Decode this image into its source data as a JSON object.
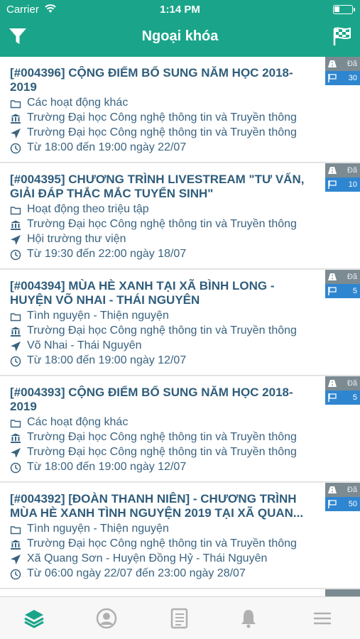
{
  "status": {
    "carrier": "Carrier",
    "time": "1:14 PM"
  },
  "nav": {
    "title": "Ngoại khóa"
  },
  "badge_label": "Đã",
  "activities": [
    {
      "title": "[#004396] CỘNG ĐIỂM BỔ SUNG NĂM HỌC 2018-2019",
      "category": "Các hoạt động khác",
      "organizer": "Trường Đại học Công nghệ thông tin và Truyền thông",
      "location": "Trường Đại học Công nghệ thông tin và Truyền thông",
      "time": "Từ 18:00 đến 19:00 ngày 22/07",
      "count": "30"
    },
    {
      "title": "[#004395] CHƯƠNG TRÌNH LIVESTREAM \"TƯ VẤN, GIẢI ĐÁP THẮC MẮC TUYỂN SINH\"",
      "category": "Hoạt động theo triệu tập",
      "organizer": "Trường Đại học Công nghệ thông tin và Truyền thông",
      "location": "Hội trường thư viện",
      "time": "Từ 19:30 đến 22:00 ngày 18/07",
      "count": "10"
    },
    {
      "title": "[#004394] MÙA HÈ XANH TẠI XÃ BÌNH LONG - HUYỆN VÕ NHAI - THÁI NGUYÊN",
      "category": "Tình nguyện - Thiện nguyện",
      "organizer": "Trường Đại học Công nghệ thông tin và Truyền thông",
      "location": "Võ Nhai - Thái Nguyên",
      "time": "Từ 18:00 đến 19:00 ngày 12/07",
      "count": "5"
    },
    {
      "title": "[#004393] CỘNG ĐIỂM BỔ SUNG NĂM HỌC 2018-2019",
      "category": "Các hoạt động khác",
      "organizer": "Trường Đại học Công nghệ thông tin và Truyền thông",
      "location": "Trường Đại học Công nghệ thông tin và Truyền thông",
      "time": "Từ 18:00 đến 19:00 ngày 12/07",
      "count": "5"
    },
    {
      "title": "[#004392] [ĐOÀN THANH NIÊN] - CHƯƠNG TRÌNH MÙA HÈ XANH TÌNH NGUYỆN 2019 TẠI XÃ QUAN...",
      "category": "Tình nguyện - Thiện nguyện",
      "organizer": "Trường Đại học Công nghệ thông tin và Truyền thông",
      "location": "Xã Quang Sơn - Huyện Đồng Hỷ - Thái Nguyên",
      "time": "Từ 06:00 ngày 22/07 đến 23:00 ngày 28/07",
      "count": "50"
    }
  ],
  "colors": {
    "header": "#1aa58a",
    "title": "#2f5d7c",
    "text": "#3a6380",
    "badge_gray": "#7c8b92",
    "badge_blue": "#2f86d0",
    "tab_active": "#1aa58a",
    "tab_inactive": "#b0b0b0"
  },
  "tabs": [
    {
      "icon": "layers-icon",
      "active": true
    },
    {
      "icon": "user-circle-icon",
      "active": false
    },
    {
      "icon": "document-list-icon",
      "active": false
    },
    {
      "icon": "bell-icon",
      "active": false
    },
    {
      "icon": "menu-icon",
      "active": false
    }
  ]
}
